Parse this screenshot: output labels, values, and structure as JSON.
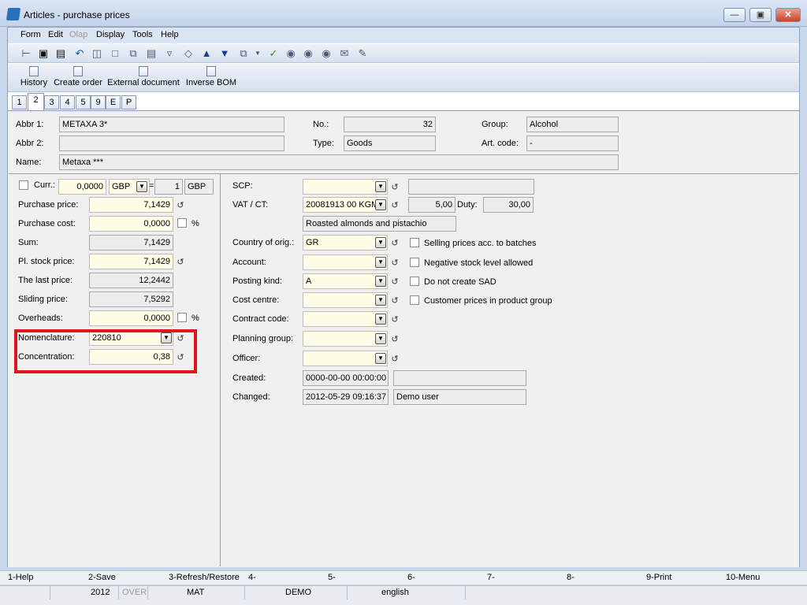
{
  "window": {
    "title": "Articles - purchase prices"
  },
  "menu": [
    "Form",
    "Edit",
    "Olap",
    "Display",
    "Tools",
    "Help"
  ],
  "toolbar2": [
    "History",
    "Create order",
    "External document",
    "Inverse BOM"
  ],
  "tabs": [
    "1",
    "2",
    "3",
    "4",
    "5",
    "9",
    "E",
    "P"
  ],
  "header": {
    "abbr1_label": "Abbr 1:",
    "abbr1": "METAXA 3*",
    "abbr2_label": "Abbr 2:",
    "abbr2": "",
    "name_label": "Name:",
    "name": "Metaxa ***",
    "no_label": "No.:",
    "no": "32",
    "type_label": "Type:",
    "type": "Goods",
    "group_label": "Group:",
    "group": "Alcohol",
    "artcode_label": "Art. code:",
    "artcode": "-"
  },
  "left": {
    "curr_label": "Curr.:",
    "curr_value": "0,0000",
    "curr_code": "GBP",
    "eq": "=",
    "rate": "1",
    "rate_code": "GBP",
    "purchase_price_label": "Purchase price:",
    "purchase_price": "7,1429",
    "purchase_cost_label": "Purchase cost:",
    "purchase_cost": "0,0000",
    "pct": "%",
    "sum_label": "Sum:",
    "sum": "7,1429",
    "pl_stock_label": "Pl. stock price:",
    "pl_stock": "7,1429",
    "last_price_label": "The last price:",
    "last_price": "12,2442",
    "sliding_label": "Sliding price:",
    "sliding": "7,5292",
    "overheads_label": "Overheads:",
    "overheads": "0,0000",
    "nomenclature_label": "Nomenclature:",
    "nomenclature": "220810",
    "concentration_label": "Concentration:",
    "concentration": "0,38"
  },
  "right": {
    "scp_label": "SCP:",
    "scp": "",
    "vat_label": "VAT / CT:",
    "vat": "20081913 00  KGM",
    "vat_rate": "5,00",
    "duty_label": "Duty:",
    "duty": "30,00",
    "vat_desc": "Roasted almonds and pistachio",
    "country_label": "Country of orig.:",
    "country": "GR",
    "account_label": "Account:",
    "account": "",
    "posting_label": "Posting kind:",
    "posting": "A",
    "cost_centre_label": "Cost centre:",
    "cost_centre": "",
    "contract_label": "Contract code:",
    "contract": "",
    "planning_label": "Planning group:",
    "planning": "",
    "officer_label": "Officer:",
    "officer": "",
    "created_label": "Created:",
    "created": "0000-00-00 00:00:00",
    "created_by": "",
    "changed_label": "Changed:",
    "changed": "2012-05-29 09:16:37",
    "changed_by": "Demo user",
    "chk_selling": "Selling prices acc. to batches",
    "chk_negative": "Negative stock level allowed",
    "chk_sad": "Do not create SAD",
    "chk_customer": "Customer prices in product group"
  },
  "fkeys": [
    "1-Help",
    "2-Save",
    "3-Refresh/Restore",
    "4-",
    "5-",
    "6-",
    "7-",
    "8-",
    "9-Print",
    "10-Menu"
  ],
  "status": [
    "2012",
    "OVER",
    "MAT",
    "DEMO",
    "english"
  ]
}
